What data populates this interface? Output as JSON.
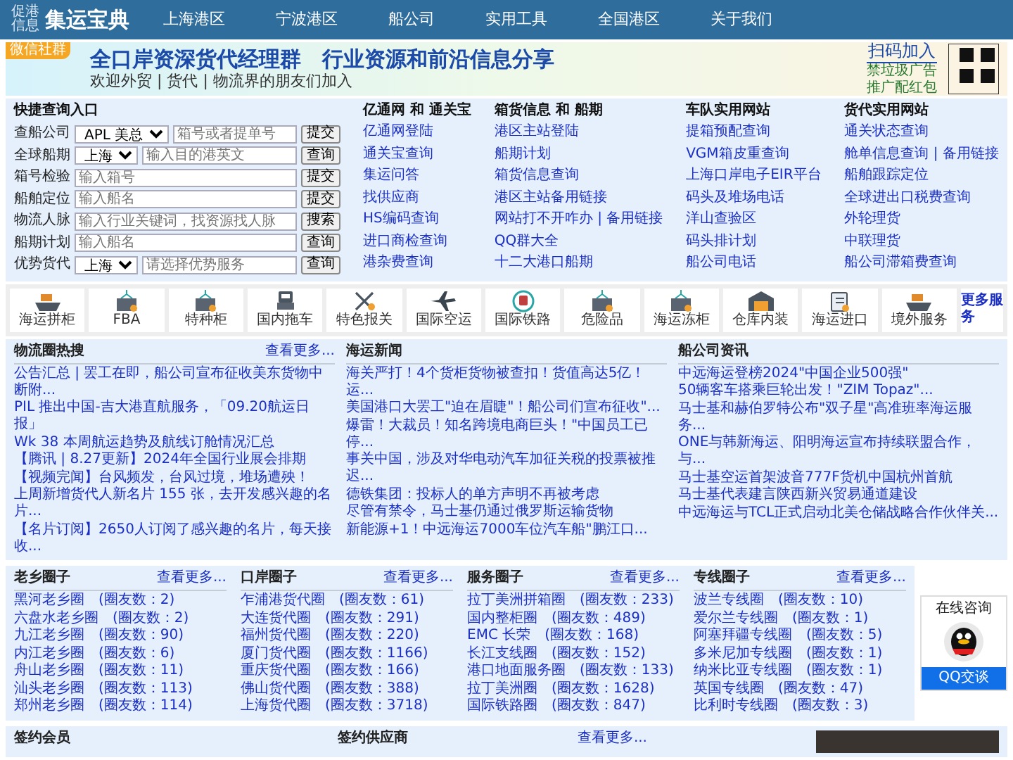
{
  "header": {
    "logo_small": [
      "促港",
      "信息"
    ],
    "logo": "集运宝典",
    "nav": [
      "上海港区",
      "宁波港区",
      "船公司",
      "实用工具",
      "全国港区",
      "关于我们"
    ]
  },
  "banner": {
    "tag": "微信社群",
    "title": "全口岸资深货代经理群　行业资源和前沿信息分享",
    "subtitle": "欢迎外贸 | 货代 | 物流界的朋友们加入",
    "cta": "扫码加入",
    "notes": [
      "禁垃圾广告",
      "推广配红包"
    ]
  },
  "query": {
    "title": "快捷查询入口",
    "rows": [
      {
        "label": "查船公司",
        "select": "APL 美总",
        "placeholder": "箱号或者提单号",
        "button": "提交"
      },
      {
        "label": "全球船期",
        "select": "上海",
        "placeholder": "输入目的港英文",
        "button": "查询"
      },
      {
        "label": "箱号检验",
        "placeholder": "输入箱号",
        "button": "提交"
      },
      {
        "label": "船舶定位",
        "placeholder": "输入船名",
        "button": "提交"
      },
      {
        "label": "物流人脉",
        "placeholder": "输入行业关键词，找资源找人脉",
        "button": "搜索"
      },
      {
        "label": "船期计划",
        "placeholder": "输入船名",
        "button": "查询"
      },
      {
        "label": "优势货代",
        "select": "上海",
        "placeholder": "请选择优势服务",
        "button": "查询"
      }
    ]
  },
  "link_columns": [
    {
      "title": "亿通网 和 通关宝",
      "links": [
        "亿通网登陆",
        "通关宝查询",
        "集运问答",
        "找供应商",
        "HS编码查询",
        "进口商检查询",
        "港杂费查询"
      ]
    },
    {
      "title": "箱货信息 和 船期",
      "links": [
        "港区主站登陆",
        "船期计划",
        "箱货信息查询",
        "港区主站备用链接",
        "网站打不开咋办 | 备用链接",
        "QQ群大全",
        "十二大港口船期"
      ]
    },
    {
      "title": "车队实用网站",
      "links": [
        "提箱预配查询",
        "VGM箱皮重查询",
        "上海口岸电子EIR平台",
        "码头及堆场电话",
        "洋山查验区",
        "码头排计划",
        "船公司电话"
      ]
    },
    {
      "title": "货代实用网站",
      "links": [
        "通关状态查询",
        "舱单信息查询 | 备用链接",
        "船舶跟踪定位",
        "全球进出口税费查询",
        "外轮理货",
        "中联理货",
        "船公司滞箱费查询"
      ]
    }
  ],
  "services": [
    {
      "label": "海运拼柜",
      "kind": "ship"
    },
    {
      "label": "FBA",
      "kind": "container"
    },
    {
      "label": "特种柜",
      "kind": "container"
    },
    {
      "label": "国内拖车",
      "kind": "truck"
    },
    {
      "label": "特色报关",
      "kind": "tools"
    },
    {
      "label": "国际空运",
      "kind": "plane"
    },
    {
      "label": "国际铁路",
      "kind": "train"
    },
    {
      "label": "危险品",
      "kind": "container"
    },
    {
      "label": "海运冻柜",
      "kind": "container"
    },
    {
      "label": "仓库内装",
      "kind": "warehouse"
    },
    {
      "label": "海运进口",
      "kind": "clipboard"
    },
    {
      "label": "境外服务",
      "kind": "ship"
    },
    {
      "label": "更多服务",
      "kind": "more"
    }
  ],
  "news": [
    {
      "title": "物流圈热搜",
      "more": "查看更多...",
      "items": [
        "公告汇总 | 罢工在即，船公司宣布征收美东货物中断附...",
        "PIL 推出中国-吉大港直航服务，「09.20航运日报」",
        "Wk 38 本周航运趋势及航线订舱情况汇总",
        "【腾讯 | 8.27更新】2024年全国行业展会排期",
        "【视频完闻】台风频发，台风过境，堆场遭殃！",
        "上周新增货代人新名片 155 张，去开发感兴趣的名片...",
        "【名片订阅】2650人订阅了感兴趣的名片，每天接收..."
      ]
    },
    {
      "title": "海运新闻",
      "items": [
        "海关严打！4个货柜货物被查扣！货值高达5亿！运...",
        "美国港口大罢工\"迫在眉睫\"！船公司们宣布征收\"...",
        "爆雷！大裁员！知名跨境电商巨头！\"中国员工已停...",
        "事关中国，涉及对华电动汽车加征关税的投票被推迟...",
        "德铁集团：投标人的单方声明不再被考虑",
        "尽管有禁令，马士基仍通过俄罗斯运输货物",
        "新能源+1！中远海运7000车位汽车船\"鹏江口..."
      ]
    },
    {
      "title": "船公司资讯",
      "items": [
        "中远海运登榜2024\"中国企业500强\"",
        "50辆客车搭乘巨轮出发！\"ZIM Topaz\"...",
        "马士基和赫伯罗特公布\"双子星\"高准班率海运服务...",
        "ONE与韩新海运、阳明海运宣布持续联盟合作，与...",
        "马士基空运首架波音777F货机中国杭州首航",
        "马士基代表建言陕西新兴贸易通道建设",
        "中远海运与TCL正式启动北美仓储战略合作伙伴关..."
      ]
    }
  ],
  "circles": [
    {
      "title": "老乡圈子",
      "more": "查看更多...",
      "items": [
        [
          "黑河老乡圈",
          "(圈友数：2)"
        ],
        [
          "六盘水老乡圈",
          "(圈友数：2)"
        ],
        [
          "九江老乡圈",
          "(圈友数：90)"
        ],
        [
          "内江老乡圈",
          "(圈友数：6)"
        ],
        [
          "舟山老乡圈",
          "(圈友数：11)"
        ],
        [
          "汕头老乡圈",
          "(圈友数：113)"
        ],
        [
          "郑州老乡圈",
          "(圈友数：114)"
        ]
      ]
    },
    {
      "title": "口岸圈子",
      "more": "查看更多...",
      "items": [
        [
          "乍浦港货代圈",
          "(圈友数：61)"
        ],
        [
          "大连货代圈",
          "(圈友数：291)"
        ],
        [
          "福州货代圈",
          "(圈友数：220)"
        ],
        [
          "厦门货代圈",
          "(圈友数：1166)"
        ],
        [
          "重庆货代圈",
          "(圈友数：166)"
        ],
        [
          "佛山货代圈",
          "(圈友数：388)"
        ],
        [
          "上海货代圈",
          "(圈友数：3718)"
        ]
      ]
    },
    {
      "title": "服务圈子",
      "more": "查看更多...",
      "items": [
        [
          "拉丁美洲拼箱圈",
          "(圈友数：233)"
        ],
        [
          "国内整柜圈",
          "(圈友数：489)"
        ],
        [
          "EMC 长荣",
          "(圈友数：168)"
        ],
        [
          "长江支线圈",
          "(圈友数：152)"
        ],
        [
          "港口地面服务圈",
          "(圈友数：133)"
        ],
        [
          "拉丁美洲圈",
          "(圈友数：1628)"
        ],
        [
          "国际铁路圈",
          "(圈友数：847)"
        ]
      ]
    },
    {
      "title": "专线圈子",
      "more": "查看更多...",
      "items": [
        [
          "波兰专线圈",
          "(圈友数：10)"
        ],
        [
          "爱尔兰专线圈",
          "(圈友数：1)"
        ],
        [
          "阿塞拜疆专线圈",
          "(圈友数：5)"
        ],
        [
          "多米尼加专线圈",
          "(圈友数：1)"
        ],
        [
          "纳米比亚专线圈",
          "(圈友数：1)"
        ],
        [
          "英国专线圈",
          "(圈友数：47)"
        ],
        [
          "比利时专线圈",
          "(圈友数：3)"
        ]
      ]
    }
  ],
  "chat_widget": {
    "title": "在线咨询",
    "button": "QQ交谈"
  },
  "bottom": [
    {
      "title": "签约会员"
    },
    {
      "title": "签约供应商",
      "more": "查看更多..."
    }
  ]
}
